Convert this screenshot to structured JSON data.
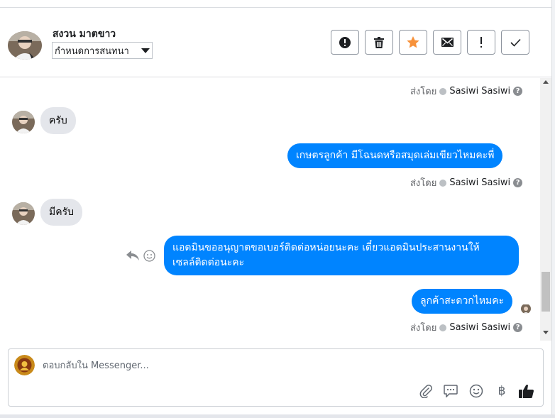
{
  "header": {
    "contact_name": "สงวน มาตขาว",
    "status_value": "กำหนดการสนทนา",
    "buttons": [
      {
        "name": "spam-button",
        "icon": "alert-circle-icon"
      },
      {
        "name": "delete-button",
        "icon": "trash-icon"
      },
      {
        "name": "star-button",
        "icon": "star-icon"
      },
      {
        "name": "mark-unread-button",
        "icon": "envelope-icon"
      },
      {
        "name": "follow-up-button",
        "icon": "exclamation-icon"
      },
      {
        "name": "mark-done-button",
        "icon": "checkmark-icon"
      }
    ]
  },
  "messages": [
    {
      "type": "sent_meta",
      "label": "ส่งโดย",
      "sender": "Sasiwi Sasiwi"
    },
    {
      "type": "in",
      "text": "ครับ"
    },
    {
      "type": "out",
      "text": "เกษตรลูกค้า มีโฉนดหรือสมุดเล่มเขียวไหมคะพี่"
    },
    {
      "type": "sent_meta",
      "label": "ส่งโดย",
      "sender": "Sasiwi Sasiwi"
    },
    {
      "type": "in",
      "text": "มีครับ"
    },
    {
      "type": "out",
      "lines": [
        "แอดมินขออนุญาตขอเบอร์ติดต่อหน่อยนะคะ เดี๋ยวแอดมินประสานงานให้",
        "เซลล์ติดต่อนะคะ"
      ]
    },
    {
      "type": "out",
      "text": "ลูกค้าสะดวกไหมคะ"
    },
    {
      "type": "sent_meta",
      "label": "ส่งโดย",
      "sender": "Sasiwi Sasiwi"
    }
  ],
  "composer": {
    "placeholder": "ตอบกลับใน Messenger...",
    "icons": [
      "paperclip-icon",
      "saved-reply-icon",
      "emoji-icon",
      "baht-icon",
      "thumbs-up-icon"
    ]
  },
  "colors": {
    "accent": "#0084ff",
    "incoming_bubble": "#e4e6eb",
    "star": "#f7923b"
  }
}
